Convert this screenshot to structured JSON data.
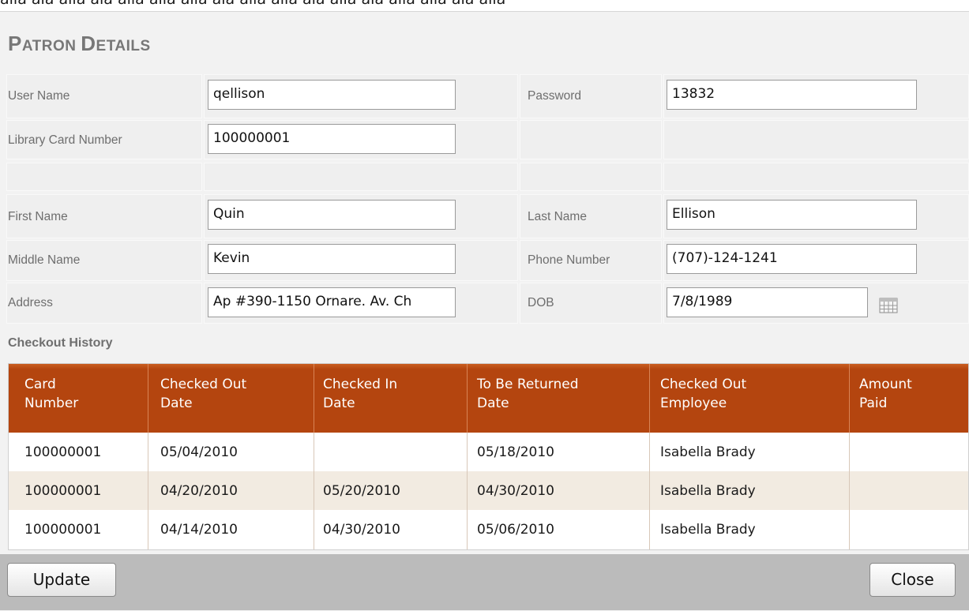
{
  "top_fragment": "alia aia alia ala alia alia alia aia alia alia ala alia aia alia alia ala alia",
  "title": {
    "first_cap": "P",
    "first_rest": "ATRON ",
    "second_cap": "D",
    "second_rest": "ETAILS"
  },
  "form": {
    "username": {
      "label": "User Name",
      "value": "qellison"
    },
    "password": {
      "label": "Password",
      "value": "13832"
    },
    "card": {
      "label": "Library Card Number",
      "value": "100000001"
    },
    "first_name": {
      "label": "First Name",
      "value": "Quin"
    },
    "last_name": {
      "label": "Last Name",
      "value": "Ellison"
    },
    "middle_name": {
      "label": "Middle Name",
      "value": "Kevin"
    },
    "phone": {
      "label": "Phone Number",
      "value": "(707)-124-1241"
    },
    "address": {
      "label": "Address",
      "value": "Ap #390-1150 Ornare. Av. Ch"
    },
    "dob": {
      "label": "DOB",
      "value": "7/8/1989"
    }
  },
  "icons": {
    "calendar": "calendar-icon"
  },
  "history": {
    "label": "Checkout History",
    "header_color": "#b4450f",
    "columns": [
      {
        "line1": "Card",
        "line2": "Number"
      },
      {
        "line1": "Checked Out",
        "line2": "Date"
      },
      {
        "line1": "Checked In",
        "line2": "Date"
      },
      {
        "line1": "To Be Returned",
        "line2": "Date"
      },
      {
        "line1": "Checked Out",
        "line2": "Employee"
      },
      {
        "line1": "Amount",
        "line2": "Paid"
      }
    ],
    "rows": [
      [
        "100000001",
        "05/04/2010",
        "",
        "05/18/2010",
        "Isabella Brady",
        ""
      ],
      [
        "100000001",
        "04/20/2010",
        "05/20/2010",
        "04/30/2010",
        "Isabella Brady",
        ""
      ],
      [
        "100000001",
        "04/14/2010",
        "04/30/2010",
        "05/06/2010",
        "Isabella Brady",
        ""
      ]
    ]
  },
  "buttons": {
    "update": "Update",
    "close": "Close"
  }
}
